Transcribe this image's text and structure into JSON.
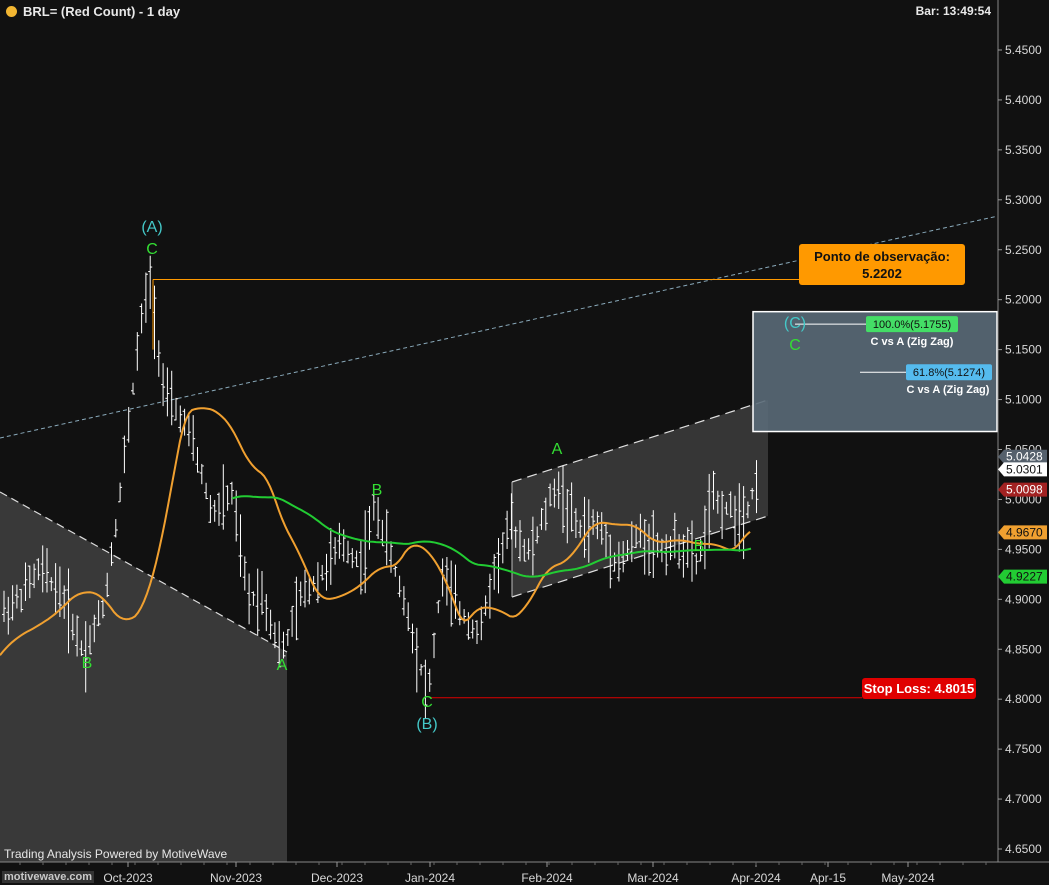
{
  "header": {
    "title": "BRL= (Red Count) - 1 day",
    "bar_time": "Bar: 13:49:54"
  },
  "footer": {
    "watermark": "Trading Analysis Powered by MotiveWave",
    "logo": "motivewave.com"
  },
  "colors": {
    "background": "#111111",
    "bars": "#ffffff",
    "orange_ma": "#f0a030",
    "green_ma": "#22cc33",
    "wave_green": "#33dd33",
    "wave_cyan": "#44c8c8",
    "observation": "#ff9900",
    "stop_loss": "#e00000",
    "target_box": "#5a6a78",
    "trendline": "#8aaabb"
  },
  "chart_data": {
    "type": "ohlc",
    "symbol": "BRL=",
    "timeframe": "1 day",
    "ylim": [
      4.635,
      5.505
    ],
    "y_ticks": [
      "5.4500",
      "5.4000",
      "5.3500",
      "5.3000",
      "5.2500",
      "5.2000",
      "5.1500",
      "5.1000",
      "5.0500",
      "5.0000",
      "4.9500",
      "4.9000",
      "4.8500",
      "4.8000",
      "4.7500",
      "4.7000",
      "4.6500"
    ],
    "x_ticks": [
      "Oct-2023",
      "Nov-2023",
      "Dec-2023",
      "Jan-2024",
      "Feb-2024",
      "Mar-2024",
      "Apr-2024",
      "Apr-15",
      "May-2024"
    ],
    "price_labels": [
      {
        "value": "5.0428",
        "style": "slate"
      },
      {
        "value": "5.0301",
        "style": "white"
      },
      {
        "value": "5.0098",
        "style": "red"
      },
      {
        "value": "4.9670",
        "style": "orange"
      },
      {
        "value": "4.9227",
        "style": "green"
      }
    ],
    "anchors": {
      "sep_high": 5.2202,
      "oct_low_B": 4.845,
      "nov_low_A": 4.845,
      "dec_high_B": 4.995,
      "jan_low_C": 4.8015,
      "feb_high_A": 5.015,
      "mar_low_B": 4.935,
      "last_close": 5.0301
    },
    "wave_labels": [
      {
        "text": "(A)",
        "color": "cyan",
        "anchor": "sep_high"
      },
      {
        "text": "C",
        "color": "green",
        "anchor": "sep_high"
      },
      {
        "text": "B",
        "color": "green",
        "anchor": "oct_low_B"
      },
      {
        "text": "A",
        "color": "green",
        "anchor": "nov_low_A"
      },
      {
        "text": "B",
        "color": "green",
        "anchor": "dec_high_B"
      },
      {
        "text": "C",
        "color": "green",
        "anchor": "jan_low_C"
      },
      {
        "text": "(B)",
        "color": "cyan",
        "anchor": "jan_low_C"
      },
      {
        "text": "A",
        "color": "green",
        "anchor": "feb_high_A"
      },
      {
        "text": "B",
        "color": "green",
        "anchor": "mar_low_B"
      },
      {
        "text": "(C)",
        "color": "cyan",
        "anchor": "target"
      },
      {
        "text": "C",
        "color": "green",
        "anchor": "target"
      }
    ],
    "observation": {
      "label": "Ponto de observação:",
      "value": "5.2202"
    },
    "stop_loss": {
      "label": "Stop Loss: 4.8015",
      "value": 4.8015
    },
    "fib_targets": [
      {
        "label": "100.0%(5.1755)",
        "caption": "C vs A (Zig Zag)",
        "value": 5.1755,
        "color": "green"
      },
      {
        "label": "61.8%(5.1274)",
        "caption": "C vs A (Zig Zag)",
        "value": 5.1274,
        "color": "cyan"
      }
    ],
    "target_zone": [
      5.068,
      5.188
    ],
    "green_ma_path": [
      [
        4.995,
        "oct-end"
      ],
      [
        4.925,
        "apr"
      ]
    ],
    "grid": false
  }
}
